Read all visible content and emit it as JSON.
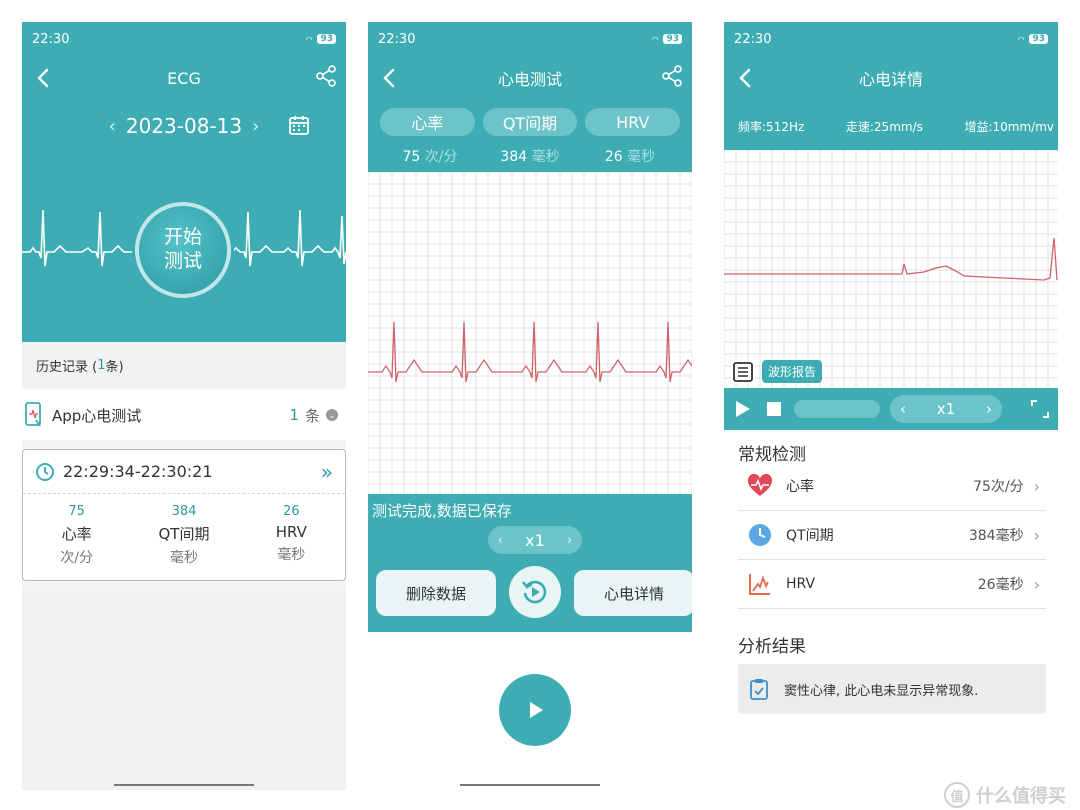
{
  "status": {
    "time": "22:30",
    "battery": "93"
  },
  "p1": {
    "title": "ECG",
    "date": "2023-08-13",
    "start_line1": "开始",
    "start_line2": "测试",
    "history_prefix": "历史记录 (",
    "history_count": "1",
    "history_suffix": "条)",
    "app_label": "App心电测试",
    "app_count": "1",
    "app_unit": "条",
    "record_time": "22:29:34-22:30:21",
    "stats": [
      {
        "value": "75",
        "name": "心率",
        "unit": "次/分"
      },
      {
        "value": "384",
        "name": "QT间期",
        "unit": "毫秒"
      },
      {
        "value": "26",
        "name": "HRV",
        "unit": "毫秒"
      }
    ]
  },
  "p2": {
    "title": "心电测试",
    "tabs": [
      "心率",
      "QT间期",
      "HRV"
    ],
    "values": [
      {
        "v": "75",
        "u": "次/分"
      },
      {
        "v": "384",
        "u": "毫秒"
      },
      {
        "v": "26",
        "u": "毫秒"
      }
    ],
    "done_text": "测试完成,数据已保存",
    "speed": "x1",
    "delete_label": "删除数据",
    "detail_label": "心电详情"
  },
  "p3": {
    "title": "心电详情",
    "freq": "频率:512Hz",
    "paper_speed": "走速:25mm/s",
    "gain": "增益:10mm/mv",
    "report_label": "波形报告",
    "speed": "x1",
    "routine_title": "常规检测",
    "items": [
      {
        "name": "心率",
        "value": "75次/分"
      },
      {
        "name": "QT间期",
        "value": "384毫秒"
      },
      {
        "name": "HRV",
        "value": "26毫秒"
      }
    ],
    "analysis_title": "分析结果",
    "analysis_text": "窦性心律, 此心电未显示异常现象."
  },
  "watermark": "什么值得买",
  "colors": {
    "teal": "#3eadb3",
    "ecg_line": "#d0626a",
    "grid": "#c4c7c9"
  }
}
